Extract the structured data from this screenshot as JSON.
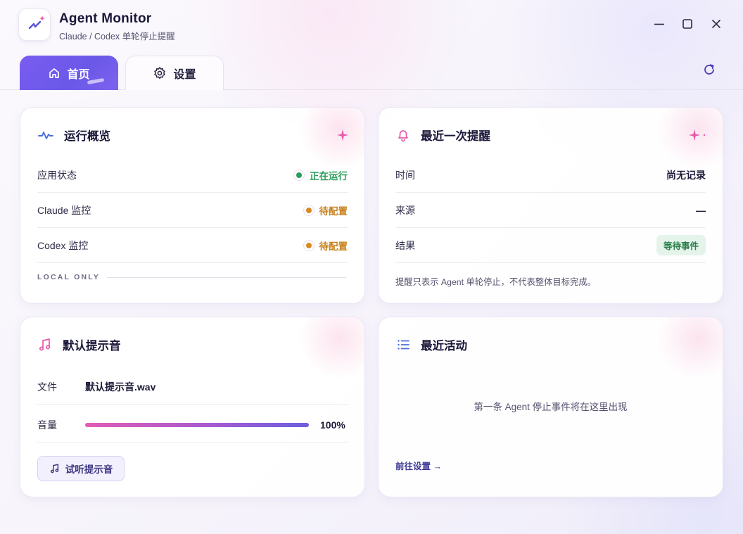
{
  "app": {
    "title": "Agent Monitor",
    "subtitle": "Claude / Codex 单轮停止提醒"
  },
  "window_controls": [
    "minimize-icon",
    "maximize-icon",
    "close-icon"
  ],
  "tabs": [
    {
      "label": "首页",
      "icon": "home-icon",
      "active": true
    },
    {
      "label": "设置",
      "icon": "gear-icon",
      "active": false
    }
  ],
  "colors": {
    "accent": "#6c5ce7",
    "running_green": "#2a9d5c",
    "pending_orange": "#d98a20",
    "sparkle_pink": "#e85aa8"
  },
  "overview": {
    "title": "运行概览",
    "icon": "activity-icon",
    "rows": [
      {
        "label": "应用状态",
        "status": "正在运行",
        "state": "running"
      },
      {
        "label": "Claude 监控",
        "status": "待配置",
        "state": "pending"
      },
      {
        "label": "Codex 监控",
        "status": "待配置",
        "state": "pending"
      }
    ],
    "footer": "LOCAL ONLY"
  },
  "last_alert": {
    "title": "最近一次提醒",
    "icon": "bell-icon",
    "time_label": "时间",
    "time_value": "尚无记录",
    "source_label": "来源",
    "source_value": "—",
    "result_label": "结果",
    "result_value": "等待事件",
    "note": "提醒只表示 Agent 单轮停止，不代表整体目标完成。"
  },
  "sound": {
    "title": "默认提示音",
    "icon": "music-note-icon",
    "file_label": "文件",
    "file_value": "默认提示音.wav",
    "volume_label": "音量",
    "volume_percent": 100,
    "volume_text": "100%",
    "preview_button": "试听提示音"
  },
  "activity": {
    "title": "最近活动",
    "icon": "list-icon",
    "empty_message": "第一条 Agent 停止事件将在这里出现",
    "settings_link": "前往设置 →"
  }
}
